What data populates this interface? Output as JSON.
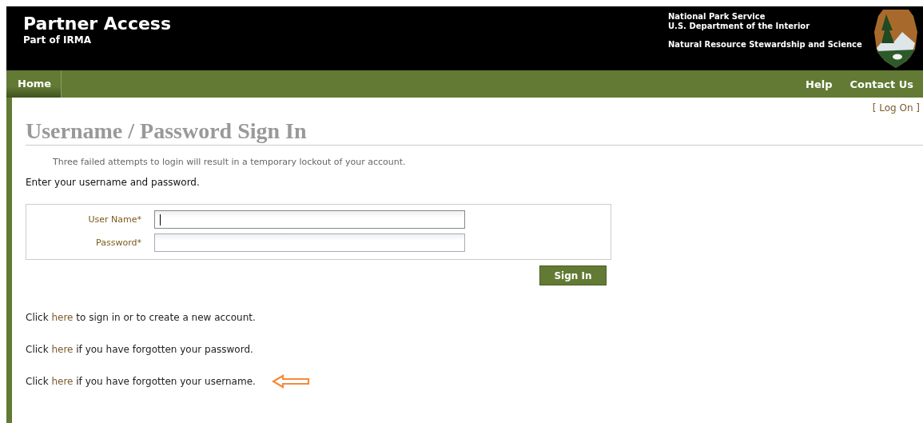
{
  "header": {
    "title": "Partner Access",
    "subtitle": "Part of IRMA",
    "agency_lines": [
      "National Park Service",
      "U.S. Department of the Interior"
    ],
    "program": "Natural Resource Stewardship and Science"
  },
  "nav": {
    "left": [
      {
        "label": "Home",
        "selected": true
      }
    ],
    "right": [
      {
        "label": "Help"
      },
      {
        "label": "Contact Us"
      }
    ]
  },
  "log_on": "[ Log On ]",
  "heading": "Username / Password Sign In",
  "notice": "Three failed attempts to login will result in a temporary lockout of your account.",
  "instruction": "Enter your username and password.",
  "fields": [
    {
      "label": "User Name*",
      "focused": true
    },
    {
      "label": "Password*",
      "focused": false
    }
  ],
  "submit": "Sign In",
  "help_lines": [
    {
      "before": "Click",
      "link": "here",
      "after": "to sign in or to create a new account.",
      "pointed": false
    },
    {
      "before": "Click",
      "link": "here",
      "after": "if you have forgotten your password.",
      "pointed": false
    },
    {
      "before": "Click",
      "link": "here",
      "after": "if you have forgotten your username.",
      "pointed": true
    }
  ]
}
